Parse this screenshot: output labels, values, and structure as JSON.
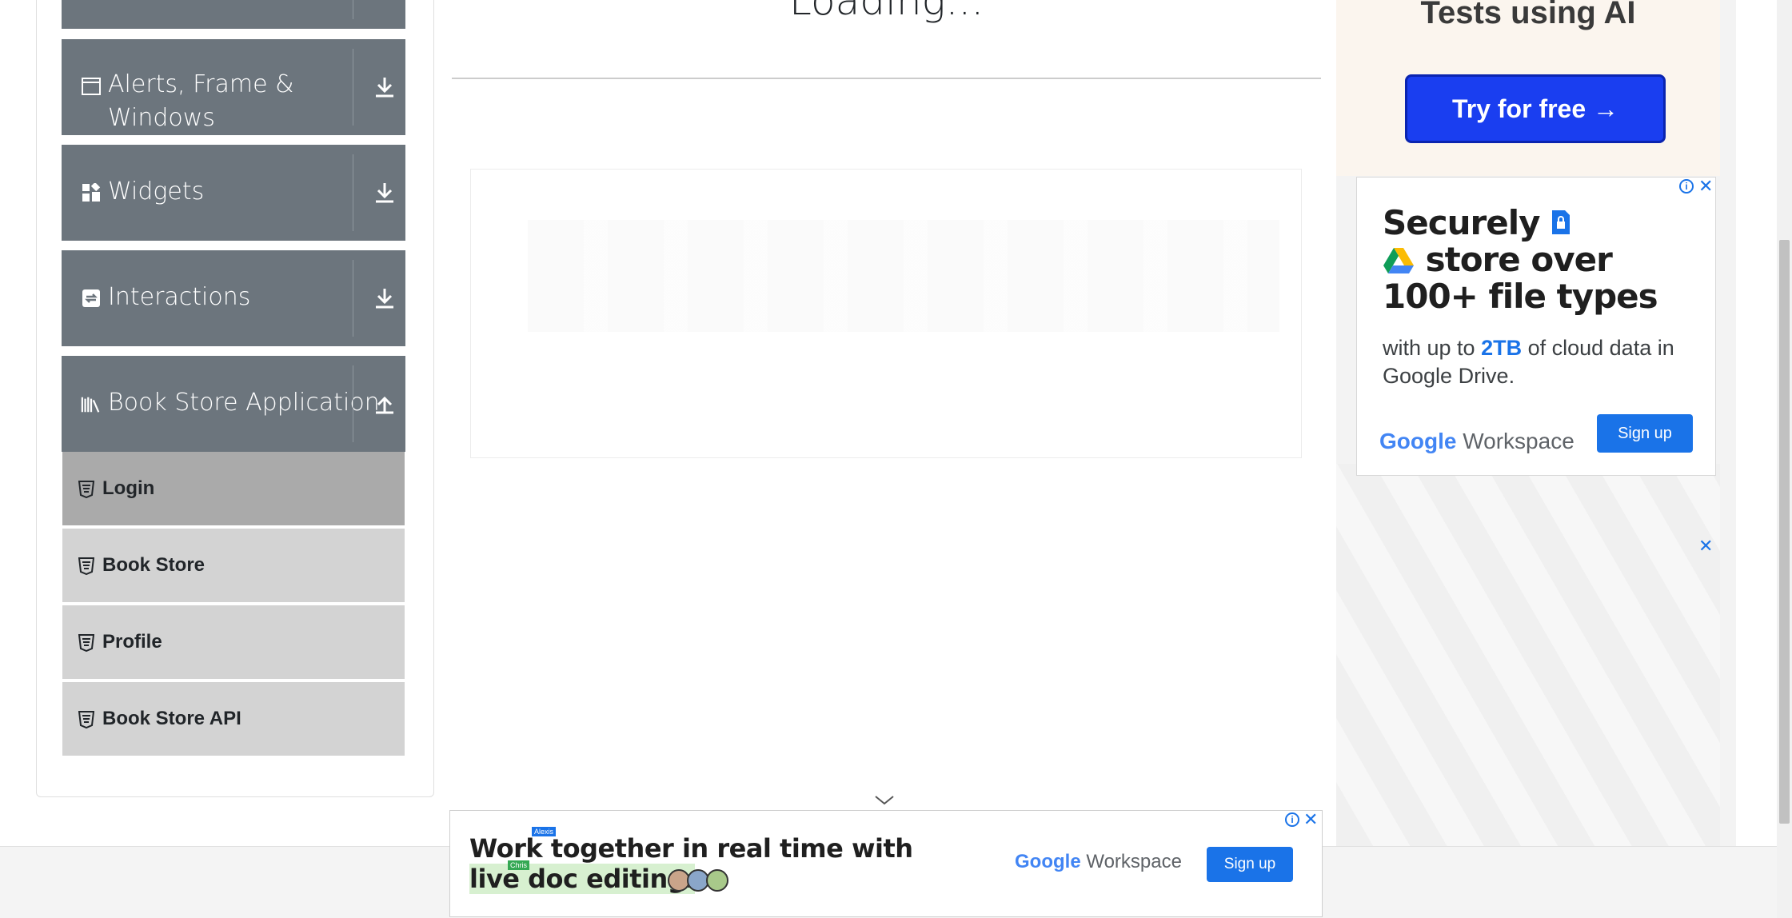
{
  "sidebar": {
    "groups": [
      {
        "label": "Alerts, Frame &",
        "label2": "Windows",
        "icon": "browser-window-icon",
        "toggle": "download-arrow-icon"
      },
      {
        "label": "Widgets",
        "icon": "widgets-icon",
        "toggle": "download-arrow-icon"
      },
      {
        "label": "Interactions",
        "icon": "interactions-icon",
        "toggle": "download-arrow-icon"
      },
      {
        "label": "Book Store Application",
        "icon": "library-icon",
        "toggle": "upload-arrow-icon"
      }
    ],
    "items": [
      {
        "label": "Login",
        "active": true
      },
      {
        "label": "Book Store"
      },
      {
        "label": "Profile"
      },
      {
        "label": "Book Store API"
      }
    ],
    "colors": {
      "group_bg": "#6c757d",
      "item_bg": "#d3d3d3",
      "active_bg": "#aaaaaa"
    }
  },
  "main": {
    "loading_text": "Loading..."
  },
  "ads": {
    "right_top": {
      "title": "Tests using AI",
      "cta": "Try for free →"
    },
    "google_workspace": {
      "headline_1": "Securely",
      "headline_2": "store over",
      "headline_3": "100+ file types",
      "body_pre": "with up to ",
      "body_highlight": "2TB",
      "body_post": " of cloud data in Google Drive.",
      "logo_word": "Google",
      "logo_suffix": "Workspace",
      "cta": "Sign up"
    },
    "bottom": {
      "line1": "Work together in real time with",
      "line2": "live doc editing.",
      "tag_top": "Alexis",
      "tag_bottom": "Chris",
      "logo_word": "Google",
      "logo_suffix": "Workspace",
      "cta": "Sign up"
    },
    "close_glyph": "✕",
    "info_glyph": "i"
  }
}
